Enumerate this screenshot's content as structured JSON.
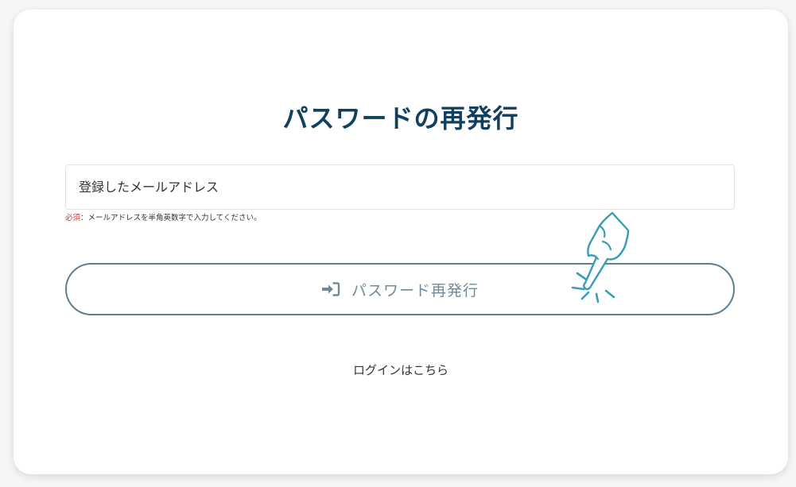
{
  "page": {
    "title": "パスワードの再発行"
  },
  "form": {
    "email_placeholder": "登録したメールアドレス",
    "email_value": "",
    "note_required": "必須",
    "note_text": "：メールアドレスを半角英数字で入力してください。",
    "submit_label": "パスワード再発行",
    "submit_icon": "sign-in-icon",
    "login_link_label": "ログインはこちら"
  },
  "colors": {
    "title": "#11405f",
    "button_border": "#5e7f93",
    "button_text": "#6e8b9b",
    "required": "#d9352b",
    "hand_pointer": "#3a9db5"
  }
}
